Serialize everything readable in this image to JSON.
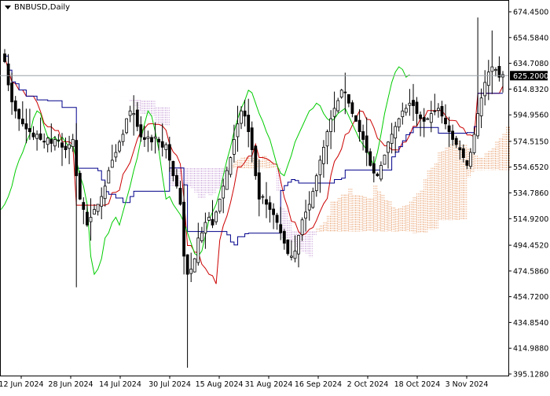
{
  "chart_data": {
    "type": "candlestick",
    "title": "BNBUSD,Daily",
    "current_price_label": "625.2000",
    "current_price": 625.2,
    "ylim": [
      395.128,
      674.45
    ],
    "y_ticks": [
      "674.4500",
      "654.5840",
      "634.7080",
      "614.8320",
      "594.9560",
      "574.5150",
      "554.6520",
      "534.7860",
      "514.9200",
      "494.4520",
      "474.5860",
      "454.7200",
      "434.8540",
      "414.9880",
      "395.1280"
    ],
    "x_ticks": [
      "12 Jun 2024",
      "28 Jun 2024",
      "14 Jul 2024",
      "30 Jul 2024",
      "15 Aug 2024",
      "31 Aug 2024",
      "16 Sep 2024",
      "2 Oct 2024",
      "18 Oct 2024",
      "3 Nov 2024"
    ],
    "colors": {
      "tenkan": "#cc0000",
      "kijun": "#00008b",
      "chikou": "#00cc00",
      "cloud_bull": "#e8a070",
      "cloud_bear": "#c8a0d8",
      "candles": "#000000",
      "price_line": "#9aa0a6"
    },
    "closes": [
      636,
      618,
      605,
      598,
      592,
      588,
      584,
      582,
      578,
      580,
      576,
      574,
      577,
      573,
      576,
      575,
      570,
      568,
      572,
      576,
      548,
      530,
      522,
      510,
      516,
      522,
      526,
      532,
      540,
      552,
      560,
      566,
      574,
      580,
      592,
      598,
      596,
      586,
      578,
      576,
      578,
      574,
      578,
      574,
      570,
      572,
      560,
      548,
      540,
      526,
      486,
      472,
      476,
      484,
      500,
      504,
      512,
      516,
      510,
      520,
      530,
      540,
      552,
      562,
      576,
      588,
      598,
      594,
      582,
      568,
      548,
      530,
      532,
      526,
      522,
      518,
      512,
      504,
      496,
      488,
      486,
      490,
      502,
      514,
      520,
      526,
      536,
      548,
      560,
      570,
      582,
      592,
      600,
      606,
      614,
      612,
      604,
      596,
      590,
      582,
      576,
      566,
      556,
      550,
      548,
      556,
      564,
      574,
      580,
      586,
      592,
      598,
      600,
      604,
      602,
      596,
      592,
      590,
      592,
      596,
      598,
      600,
      594,
      588,
      582,
      576,
      572,
      568,
      562,
      556,
      566,
      580,
      596,
      608,
      620,
      628,
      632,
      630,
      624,
      626
    ]
  }
}
